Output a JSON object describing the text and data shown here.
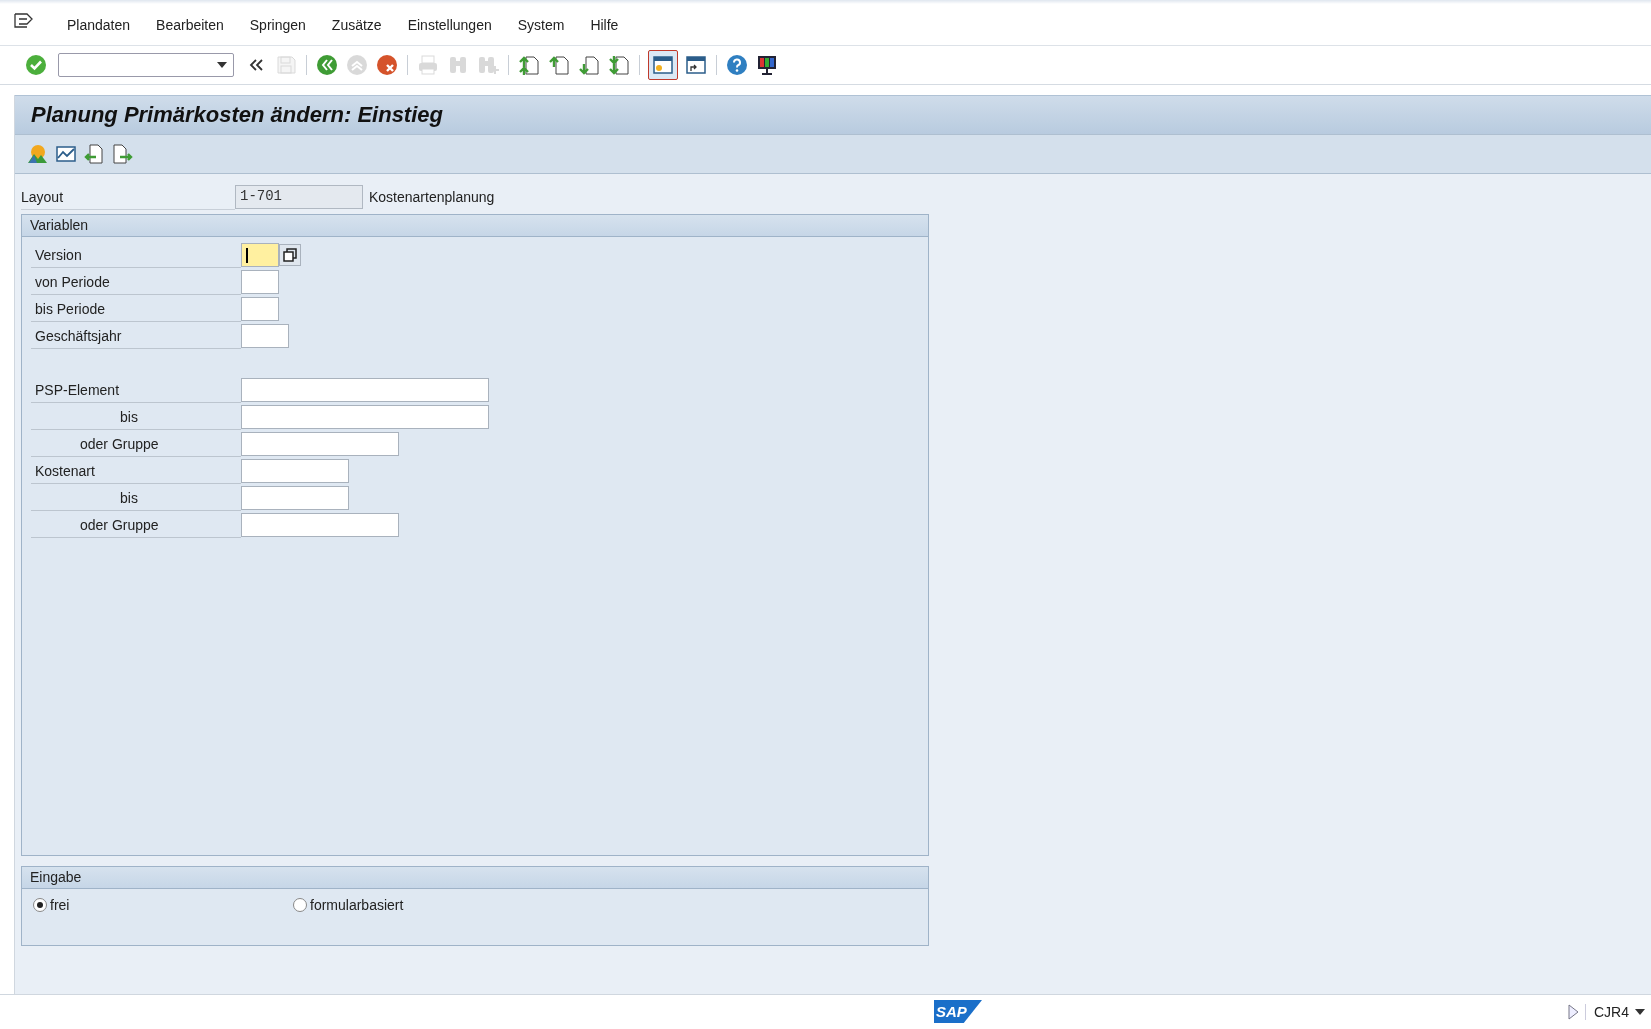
{
  "menu": [
    "Plandaten",
    "Bearbeiten",
    "Springen",
    "Zusätze",
    "Einstellungen",
    "System",
    "Hilfe"
  ],
  "toolbar": [
    {
      "kind": "enter",
      "disabled": false
    },
    {
      "kind": "command-field"
    },
    {
      "kind": "chevron",
      "disabled": false
    },
    {
      "kind": "save",
      "disabled": true
    },
    {
      "kind": "separator"
    },
    {
      "kind": "back",
      "disabled": false
    },
    {
      "kind": "exit",
      "disabled": true
    },
    {
      "kind": "cancel",
      "disabled": false
    },
    {
      "kind": "separator"
    },
    {
      "kind": "print",
      "disabled": true
    },
    {
      "kind": "find",
      "disabled": true
    },
    {
      "kind": "find-next",
      "disabled": true
    },
    {
      "kind": "separator"
    },
    {
      "kind": "first-page",
      "disabled": false
    },
    {
      "kind": "prev-page",
      "disabled": false
    },
    {
      "kind": "next-page",
      "disabled": false
    },
    {
      "kind": "last-page",
      "disabled": false
    },
    {
      "kind": "separator"
    },
    {
      "kind": "new-window",
      "disabled": false,
      "selected": true
    },
    {
      "kind": "shortcut",
      "disabled": false,
      "selected": false
    },
    {
      "kind": "separator"
    },
    {
      "kind": "help",
      "disabled": false
    },
    {
      "kind": "layout",
      "disabled": false
    }
  ],
  "title": "Planung Primärkosten ändern: Einstieg",
  "app_toolbar": [
    {
      "kind": "landscape"
    },
    {
      "kind": "chart"
    },
    {
      "kind": "import"
    },
    {
      "kind": "export"
    }
  ],
  "layout": {
    "label": "Layout",
    "value": "1-701",
    "description": "Kostenartenplanung"
  },
  "variables": {
    "title": "Variablen",
    "groups": [
      [
        {
          "label": "Version",
          "kind": "main",
          "focused": true,
          "help_button": true
        },
        {
          "label": "von Periode",
          "kind": "main",
          "focused": false,
          "help_button": false
        },
        {
          "label": "bis Periode",
          "kind": "main",
          "focused": false,
          "help_button": false
        },
        {
          "label": "Geschäftsjahr",
          "kind": "main",
          "focused": false,
          "help_button": false
        }
      ],
      [
        {
          "label": "PSP-Element",
          "kind": "main",
          "focused": false,
          "help_button": false
        },
        {
          "label": "bis",
          "kind": "range",
          "focused": false,
          "help_button": false
        },
        {
          "label": "oder Gruppe",
          "kind": "group",
          "focused": false,
          "help_button": false
        },
        {
          "label": "Kostenart",
          "kind": "main",
          "focused": false,
          "help_button": false
        },
        {
          "label": "bis",
          "kind": "range",
          "focused": false,
          "help_button": false
        },
        {
          "label": "oder Gruppe",
          "kind": "group",
          "focused": false,
          "help_button": false
        }
      ]
    ]
  },
  "input": {
    "title": "Eingabe",
    "options": [
      {
        "label": "frei",
        "selected": true
      },
      {
        "label": "formularbasiert",
        "selected": false
      }
    ]
  },
  "status_bar": {
    "logo": "SAP",
    "transaction": "CJR4"
  }
}
